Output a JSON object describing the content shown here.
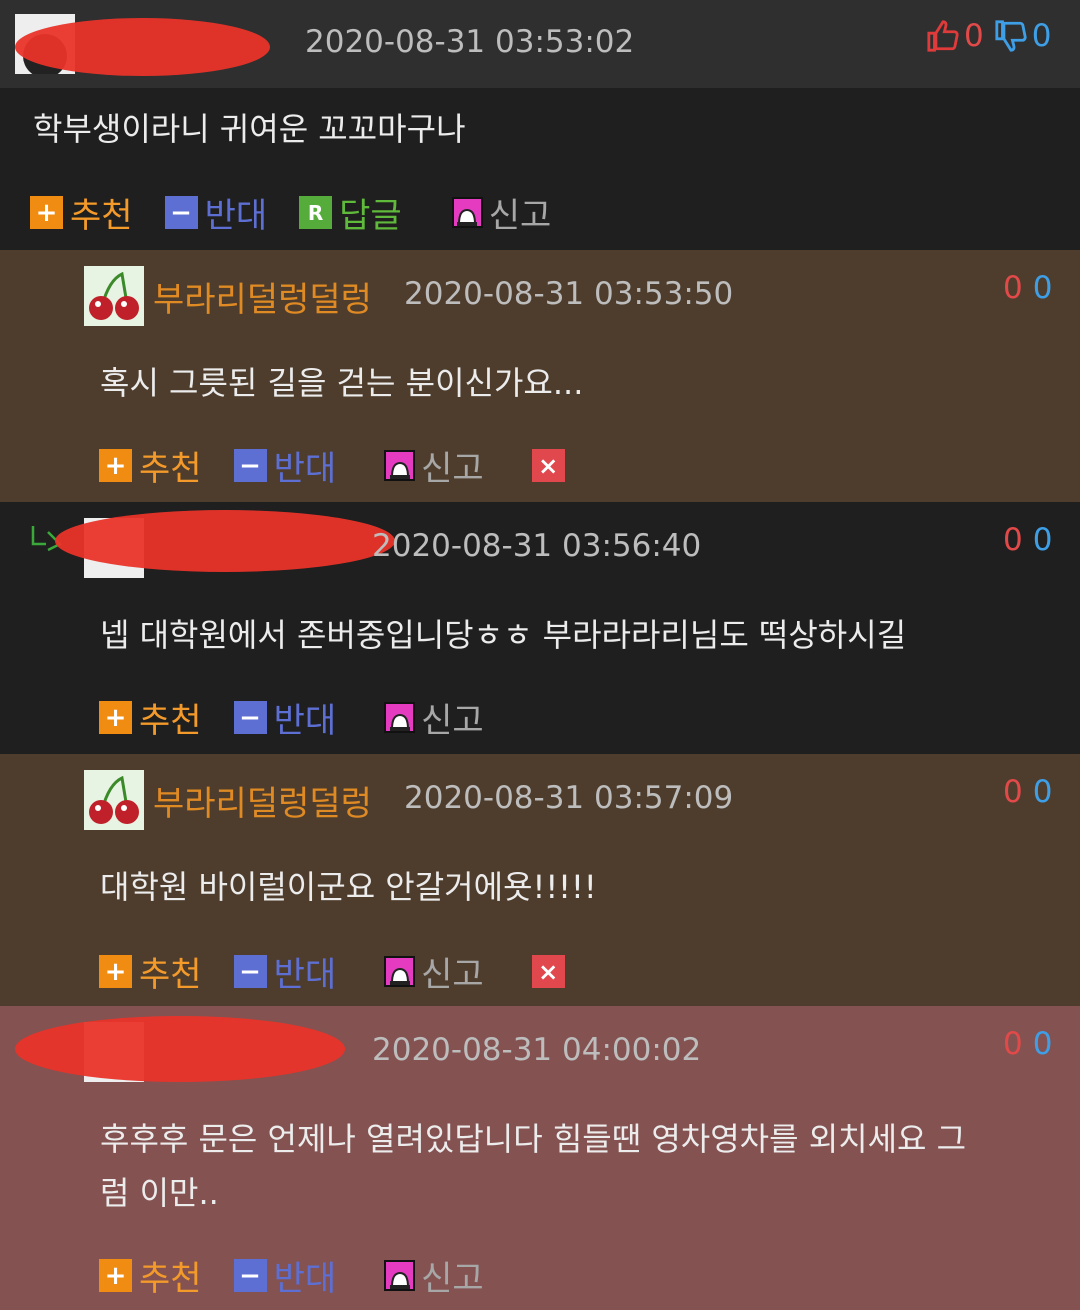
{
  "comments": [
    {
      "date": "2020-08-31 03:53:02",
      "up": "0",
      "down": "0",
      "text": "학부생이라니 귀여운 꼬꼬마구나",
      "actions": {
        "recommend": "추천",
        "oppose": "반대",
        "reply": "답글",
        "report": "신고"
      }
    },
    {
      "nick": "부라리덜렁덜렁",
      "date": "2020-08-31 03:53:50",
      "up": "0",
      "down": "0",
      "text": "혹시 그릇된 길을 걷는 분이신가요...",
      "actions": {
        "recommend": "추천",
        "oppose": "반대",
        "report": "신고"
      }
    },
    {
      "date": "2020-08-31 03:56:40",
      "up": "0",
      "down": "0",
      "text": "넵 대학원에서 존버중입니당ㅎㅎ 부라라라리님도 떡상하시길",
      "actions": {
        "recommend": "추천",
        "oppose": "반대",
        "report": "신고"
      }
    },
    {
      "nick": "부라리덜렁덜렁",
      "date": "2020-08-31 03:57:09",
      "up": "0",
      "down": "0",
      "text": "대학원 바이럴이군요 안갈거에욧!!!!!",
      "actions": {
        "recommend": "추천",
        "oppose": "반대",
        "report": "신고"
      }
    },
    {
      "date": "2020-08-31 04:00:02",
      "up": "0",
      "down": "0",
      "text": "후후후 문은 언제나 열려있답니다 힘들땐 영차영차를 외치세요 그",
      "text2": "럼 이만..",
      "actions": {
        "recommend": "추천",
        "oppose": "반대",
        "report": "신고"
      }
    }
  ],
  "colors": {
    "row1_header": "#2f2f2f",
    "row1_body": "#1f1f1f",
    "brown_row": "#4e3d2d",
    "dark_row": "#1f1f1f",
    "red_row": "#835251"
  }
}
